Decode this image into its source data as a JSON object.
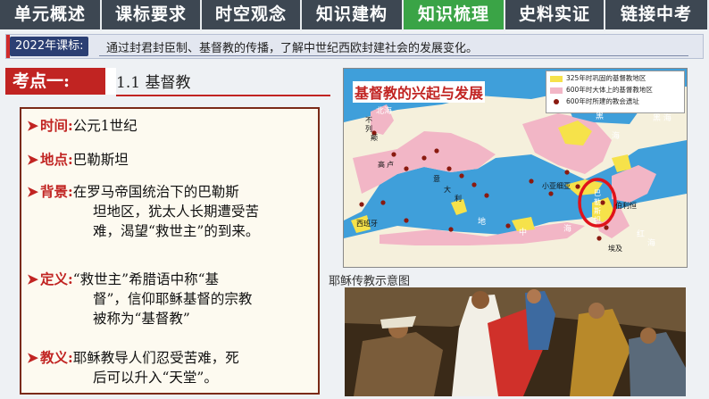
{
  "nav": {
    "tabs": [
      {
        "label": "单元概述",
        "active": false
      },
      {
        "label": "课标要求",
        "active": false
      },
      {
        "label": "时空观念",
        "active": false
      },
      {
        "label": "知识建构",
        "active": false
      },
      {
        "label": "知识梳理",
        "active": true
      },
      {
        "label": "史料实证",
        "active": false
      },
      {
        "label": "链接中考",
        "active": false
      }
    ]
  },
  "standard": {
    "label": "2022年课标:",
    "text": "通过封君封臣制、基督教的传播，了解中世纪西欧封建社会的发展变化。"
  },
  "kaodian": {
    "badge": "考点一:",
    "title": "1.1 基督教"
  },
  "items": [
    {
      "key": "时间:",
      "body": "公元1世纪"
    },
    {
      "key": "地点:",
      "body": "巴勒斯坦"
    },
    {
      "key": "背景:",
      "body_lines": [
        "在罗马帝国统治下的巴勒斯",
        "坦地区，犹太人长期遭受苦",
        "难，渴望“救世主”的到来。"
      ]
    },
    {
      "key": "定义:",
      "body_lines": [
        "“救世主”希腊语中称“基",
        "督”，信仰耶稣基督的宗教",
        "被称为“基督教”"
      ]
    },
    {
      "key": "教义:",
      "body_lines": [
        "耶稣教导人们忍受苦难，死",
        "后可以升入“天堂”。"
      ]
    }
  ],
  "map": {
    "title": "基督教的兴起与发展",
    "legend": [
      {
        "label": "325年时巩固的基督教地区",
        "color": "#f6e24a"
      },
      {
        "label": "600年时大体上的基督教地区",
        "color": "#f2b6c6"
      },
      {
        "label": "600年时所建的教会遗址",
        "color": "#8a1a10"
      }
    ],
    "places": {
      "north_sea": "北海",
      "black_sea_1": "黑",
      "black_sea_2": "海",
      "britain_1": "不",
      "britain_2": "列",
      "britain_3": "颠",
      "gaul_1": "高",
      "gaul_2": "卢",
      "italy_1": "意",
      "italy_2": "大",
      "italy_3": "利",
      "spain": "西班牙",
      "asia_minor": "小亚细亚",
      "palestine_1": "巴",
      "palestine_2": "勒",
      "palestine_3": "斯",
      "palestine_4": "坦",
      "bethlehem": "伯利恒",
      "egypt": "埃及",
      "med_1": "地",
      "med_2": "中",
      "med_3": "海",
      "red_sea_1": "红",
      "red_sea_2": "海",
      "black_sea_label": "黑 海"
    },
    "colors": {
      "sea": "#3f9fda",
      "yellow": "#f6e24a",
      "pink": "#f2b6c6",
      "land": "#f5f0dc",
      "highlight": "#e0121a"
    }
  },
  "painting": {
    "caption": "耶稣传教示意图"
  },
  "colors": {
    "accent": "#c12422",
    "nav_active": "#3aa446",
    "nav_bg": "#3d4752"
  }
}
